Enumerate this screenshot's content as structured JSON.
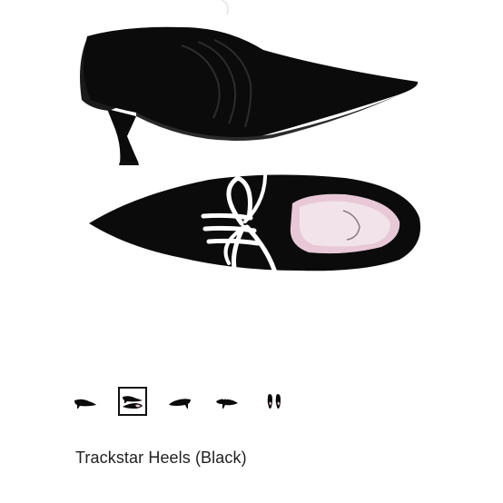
{
  "product": {
    "title": "Trackstar Heels (Black)"
  },
  "gallery": {
    "selected_index": 1,
    "thumbnails": [
      {
        "icon": "shoe-side-view-icon"
      },
      {
        "icon": "shoe-pair-view-icon"
      },
      {
        "icon": "shoe-profile-view-icon"
      },
      {
        "icon": "shoe-back-view-icon"
      },
      {
        "icon": "shoe-top-view-icon"
      }
    ]
  },
  "colors": {
    "shoe": "#0b0b0b",
    "lace": "#ffffff",
    "insole": "#e8c8d6",
    "selected_border": "#111111",
    "text": "#1f1f1f"
  }
}
